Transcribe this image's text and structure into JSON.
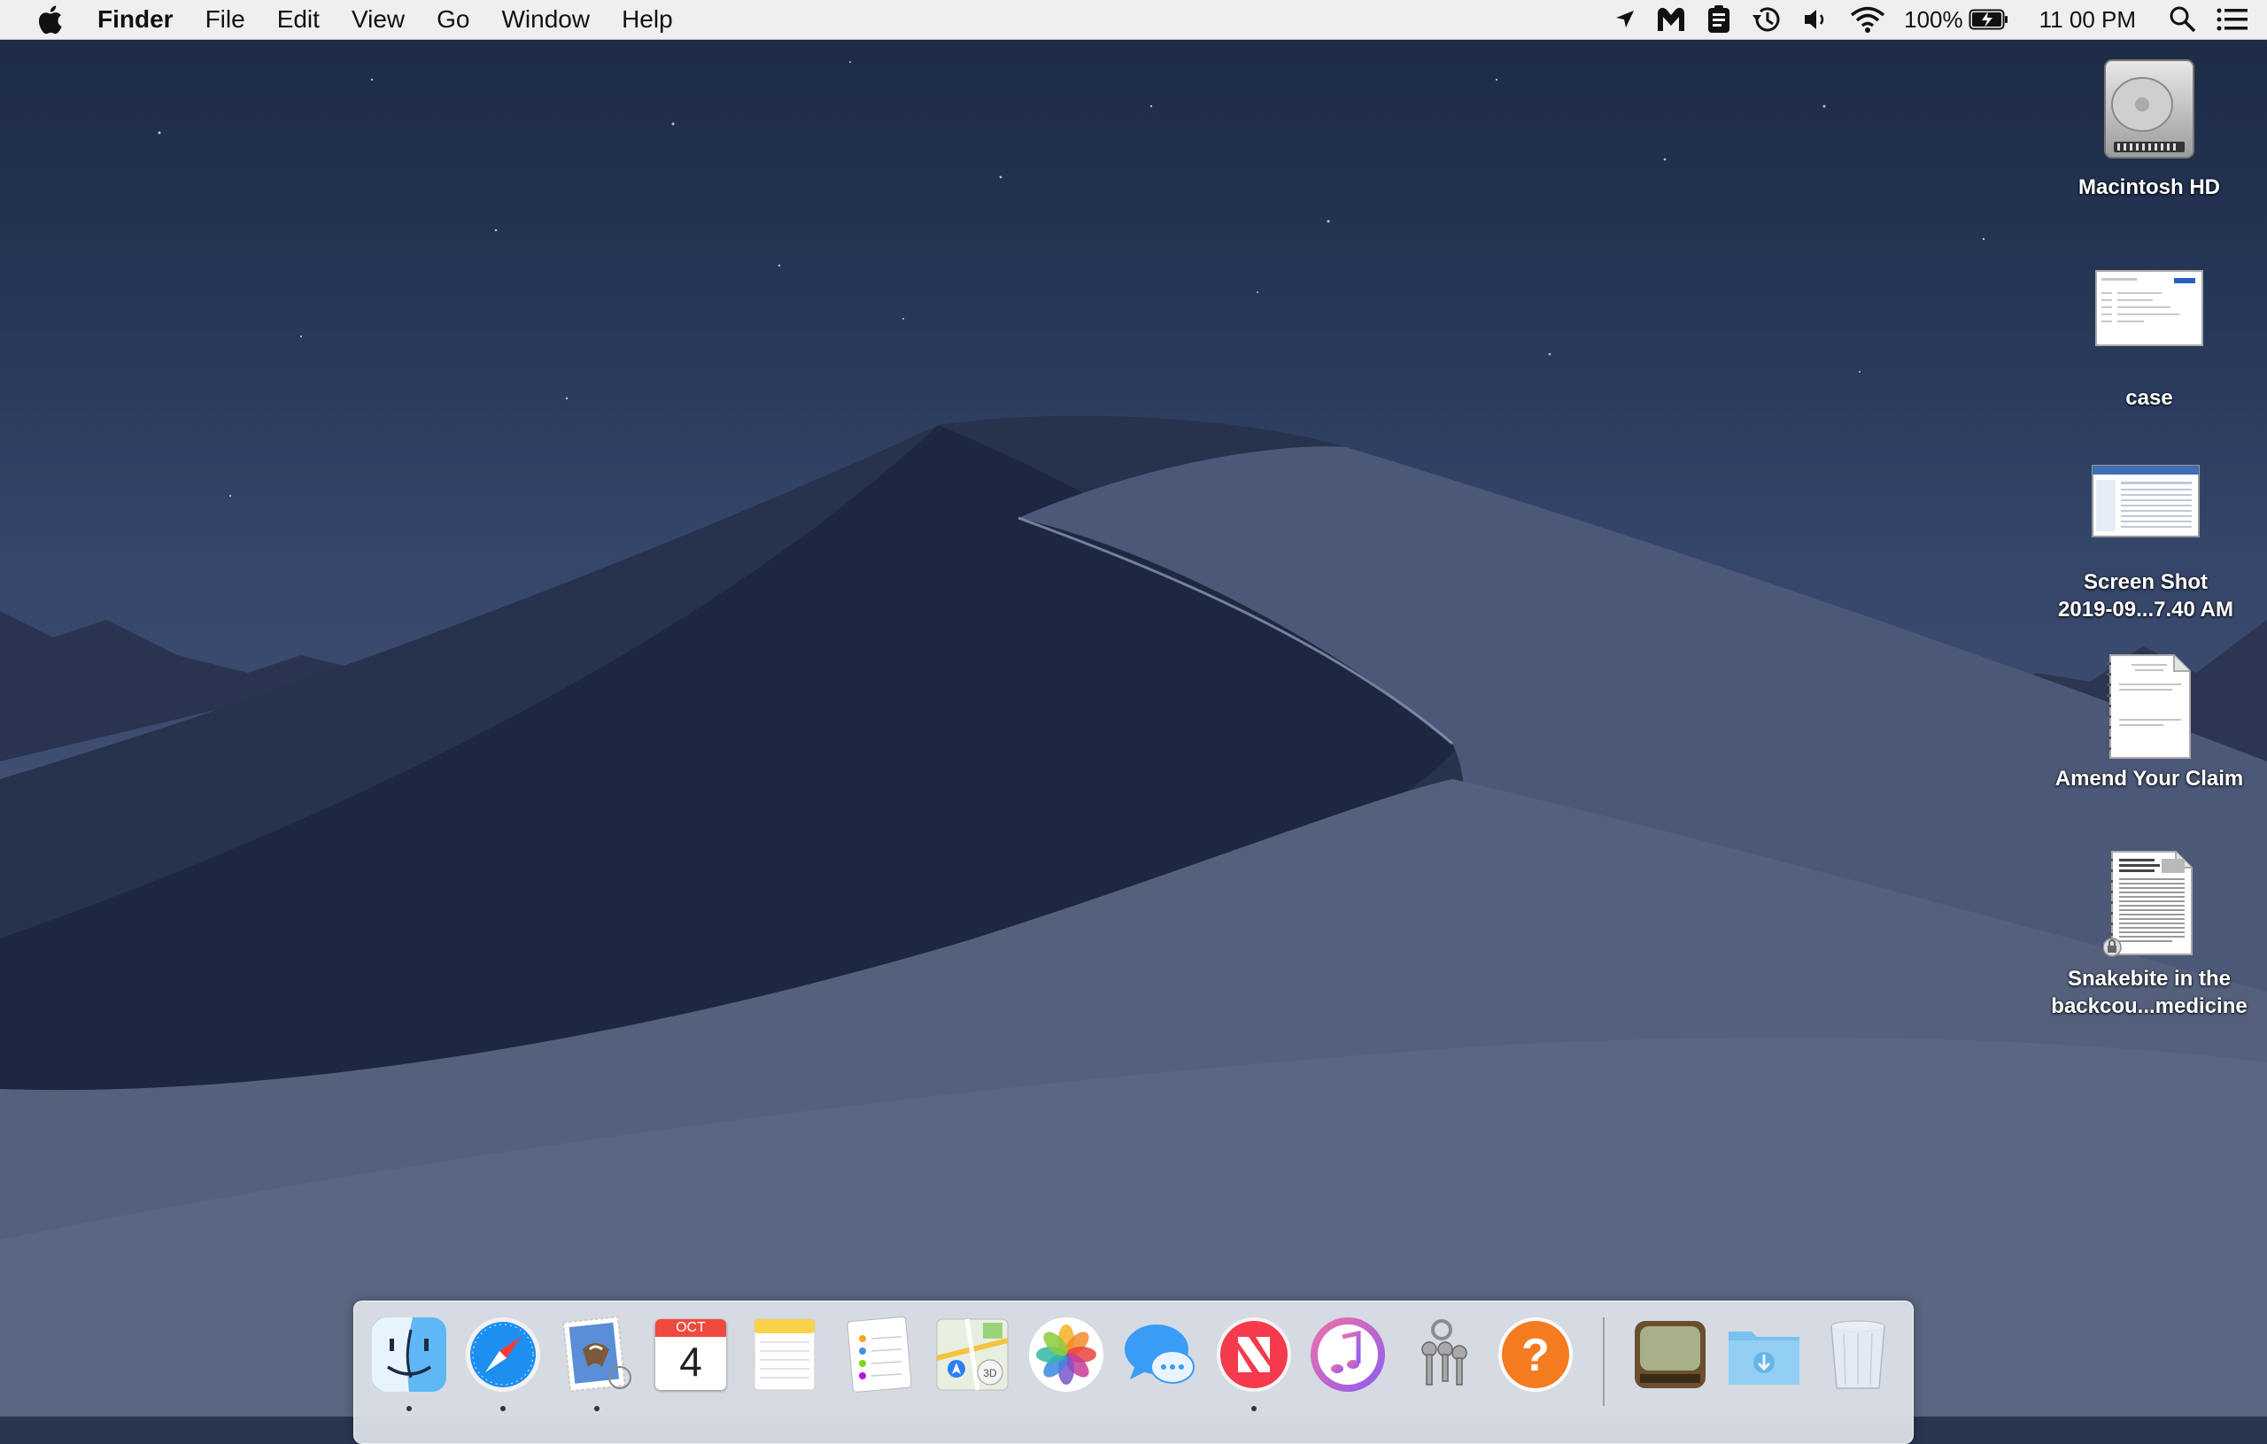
{
  "menubar": {
    "app_name": "Finder",
    "menus": [
      "File",
      "Edit",
      "View",
      "Go",
      "Window",
      "Help"
    ],
    "status": {
      "battery_percent": "100%",
      "clock": "11 00 PM",
      "icons": [
        "location-icon",
        "malwarebytes-icon",
        "clipboard-icon",
        "time-machine-icon",
        "volume-icon",
        "wifi-icon",
        "battery-icon",
        "spotlight-icon",
        "notification-center-icon"
      ]
    }
  },
  "desktop": {
    "items": [
      {
        "label": "Macintosh HD",
        "kind": "hard-drive"
      },
      {
        "label": "case",
        "kind": "document"
      },
      {
        "label": "Screen Shot\n2019-09...7.40 AM",
        "kind": "screenshot"
      },
      {
        "label": "Amend Your Claim",
        "kind": "document"
      },
      {
        "label": "Snakebite in the\nbackcou...medicine",
        "kind": "document"
      }
    ]
  },
  "dock": {
    "apps": [
      {
        "name": "Finder",
        "running": true
      },
      {
        "name": "Safari",
        "running": true
      },
      {
        "name": "Mail",
        "running": true
      },
      {
        "name": "Calendar",
        "running": false,
        "month": "OCT",
        "day": "4"
      },
      {
        "name": "Notes",
        "running": false
      },
      {
        "name": "Reminders",
        "running": false
      },
      {
        "name": "Maps",
        "running": false
      },
      {
        "name": "Photos",
        "running": false
      },
      {
        "name": "Messages",
        "running": false
      },
      {
        "name": "News",
        "running": true
      },
      {
        "name": "iTunes",
        "running": false
      },
      {
        "name": "Keychain Access",
        "running": false
      },
      {
        "name": "Tips",
        "running": false
      }
    ],
    "extras": [
      {
        "name": "Video Player"
      },
      {
        "name": "Downloads"
      },
      {
        "name": "Trash"
      }
    ]
  }
}
